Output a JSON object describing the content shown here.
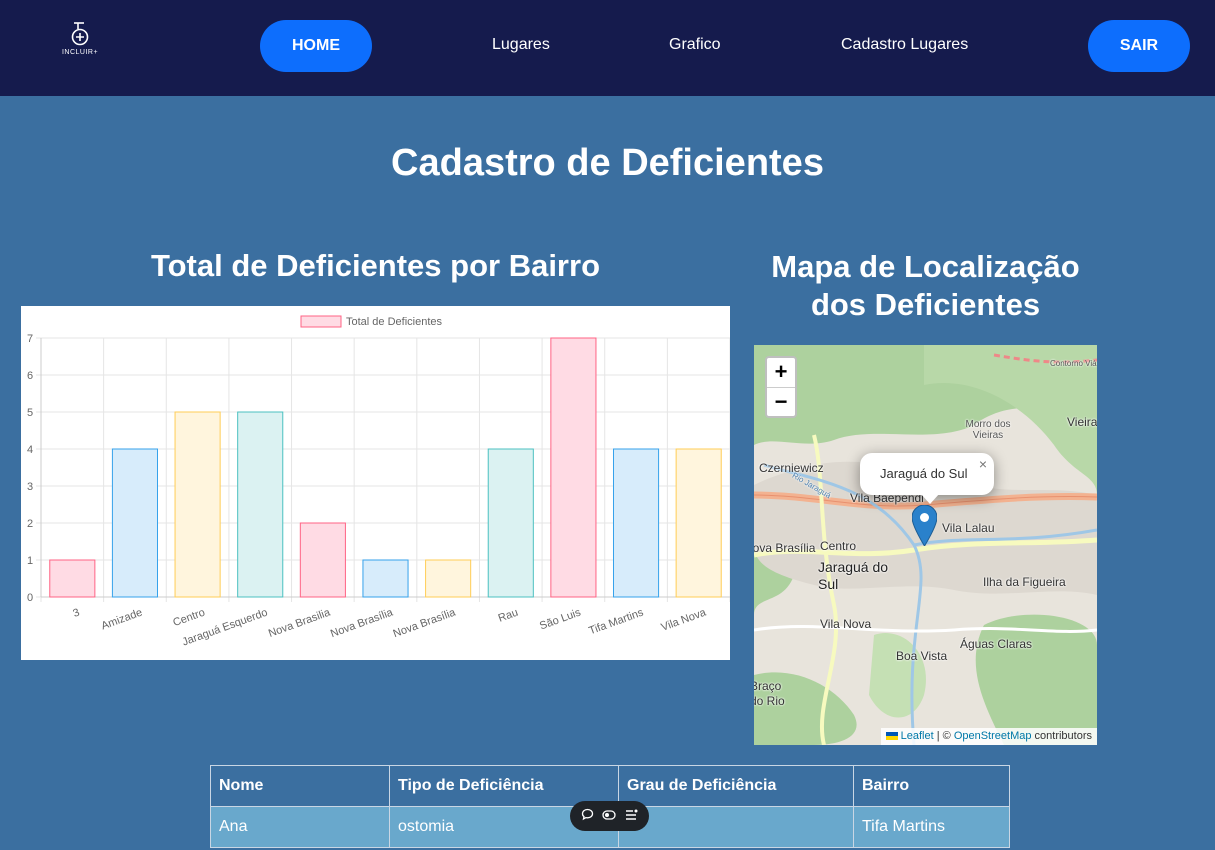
{
  "nav": {
    "logo_text": "INCLUIR+",
    "home_label": "HOME",
    "links": [
      "Lugares",
      "Grafico",
      "Cadastro Lugares"
    ],
    "logout_label": "SAIR",
    "colors": {
      "bar": "#151b4d",
      "button": "#0d6efd"
    }
  },
  "page": {
    "title": "Cadastro de Deficientes",
    "background": "#3b6fa0"
  },
  "chart_section": {
    "title": "Total de Deficientes por Bairro"
  },
  "map_section": {
    "title_line1": "Mapa de Localização",
    "title_line2": "dos Deficientes",
    "zoom_in": "+",
    "zoom_out": "−",
    "popup_text": "Jaraguá do Sul",
    "popup_close": "×",
    "labels": [
      "Czerniewicz",
      "Vila Baependi",
      "Morro dos Vieiras",
      "Vieira",
      "Vila Lalau",
      "Centro",
      "Jaraguá do Sul",
      "Ilha da Figueira",
      "Nova Brasília",
      "Vila Nova",
      "Boa Vista",
      "Águas Claras",
      "Contorno Viá",
      "Rio Jaraguá",
      "Braço do Rio"
    ],
    "attribution": {
      "leaflet": "Leaflet",
      "separator": " | © ",
      "osm": "OpenStreetMap",
      "suffix": " contributors"
    }
  },
  "chart_data": {
    "type": "bar",
    "legend": "Total de Deficientes",
    "categories": [
      "3",
      "Amizade",
      "Centro",
      "Jaraguá Esquerdo",
      "Nova Brasilia",
      "Nova Brasília",
      "Nova Brasília",
      "Rau",
      "São Luis",
      "Tifa Martins",
      "Vila Nova"
    ],
    "values": [
      1,
      4,
      5,
      5,
      2,
      1,
      1,
      4,
      7,
      4,
      4
    ],
    "ylim": [
      0,
      7
    ],
    "yticks": [
      0,
      1,
      2,
      3,
      4,
      5,
      6,
      7
    ],
    "grid": true,
    "legend_position": "top",
    "colors": [
      {
        "fill": "#ffdbe4",
        "stroke": "#ff6384"
      },
      {
        "fill": "#d7ecfb",
        "stroke": "#36a2eb"
      },
      {
        "fill": "#fff5dd",
        "stroke": "#ffcd56"
      },
      {
        "fill": "#dbf2f2",
        "stroke": "#4bc0c0"
      }
    ]
  },
  "table": {
    "headers": [
      "Nome",
      "Tipo de Deficiência",
      "Grau de Deficiência",
      "Bairro"
    ],
    "rows": [
      [
        "Ana",
        "ostomia",
        "",
        "Tifa Martins"
      ]
    ]
  }
}
